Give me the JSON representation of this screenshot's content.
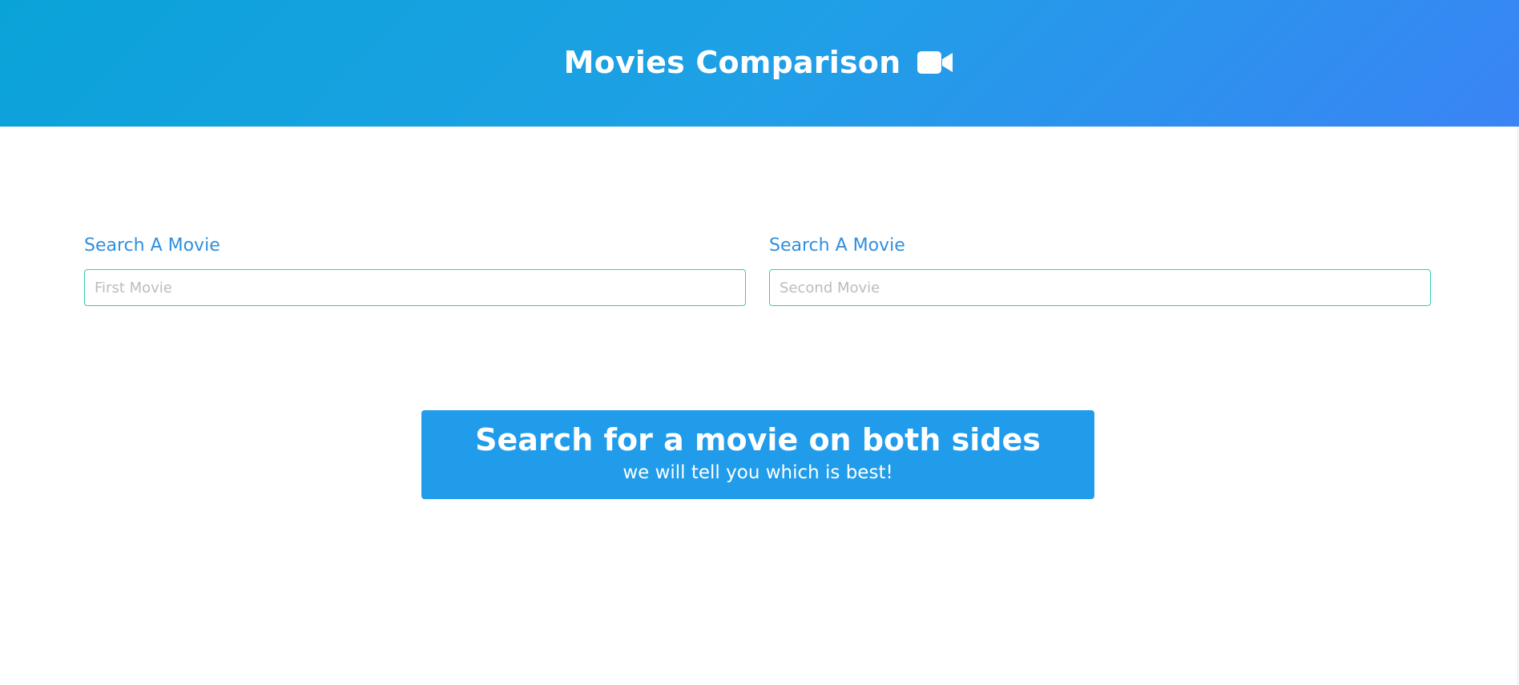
{
  "hero": {
    "title": "Movies Comparison",
    "icon": "video-camera-icon",
    "gradient": [
      "#0aa3d8",
      "#3a84f5"
    ]
  },
  "search": {
    "left": {
      "label": "Search A Movie",
      "placeholder": "First Movie",
      "value": ""
    },
    "right": {
      "label": "Search A Movie",
      "placeholder": "Second Movie",
      "value": ""
    }
  },
  "notice": {
    "title": "Search for a movie on both sides",
    "subtitle": "we will tell you which is best!",
    "color": "#219ceb"
  },
  "colors": {
    "label": "#2e8fe0",
    "input_border": "#32cfa8"
  }
}
